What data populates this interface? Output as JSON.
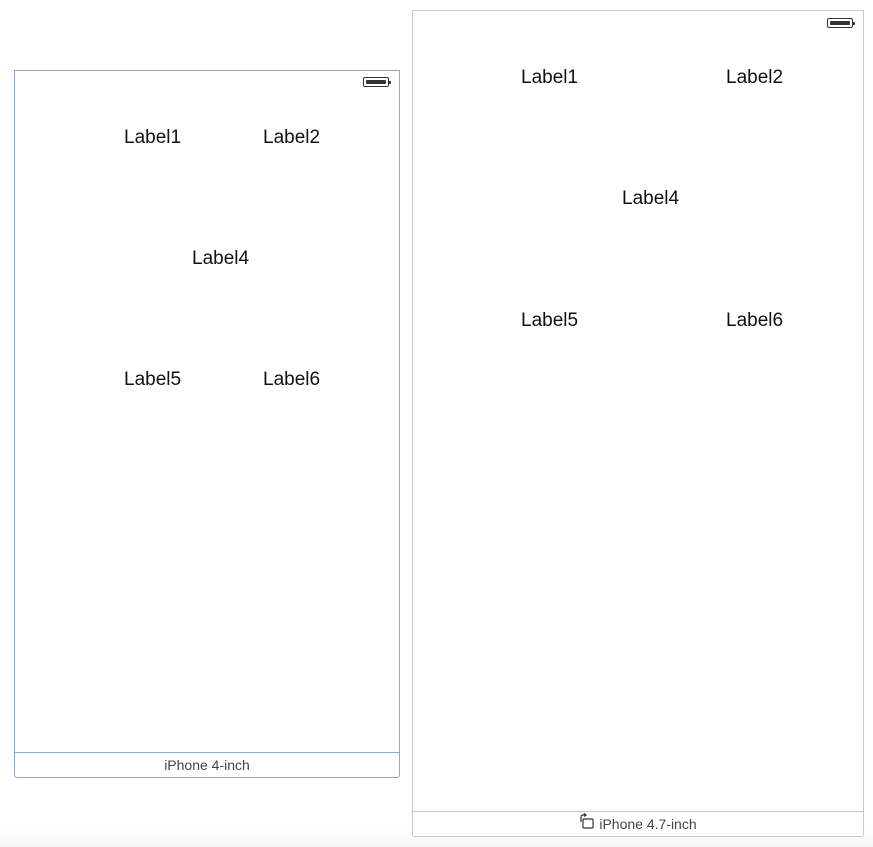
{
  "devices": {
    "small": {
      "footer_label": "iPhone 4-inch",
      "labels": [
        "Label1",
        "Label2",
        "Label4",
        "Label5",
        "Label6"
      ]
    },
    "large": {
      "footer_label": "iPhone 4.7-inch",
      "labels": [
        "Label1",
        "Label2",
        "Label4",
        "Label5",
        "Label6"
      ]
    }
  },
  "icons": {
    "status": "battery-icon",
    "rotate": "rotate-device-icon"
  }
}
